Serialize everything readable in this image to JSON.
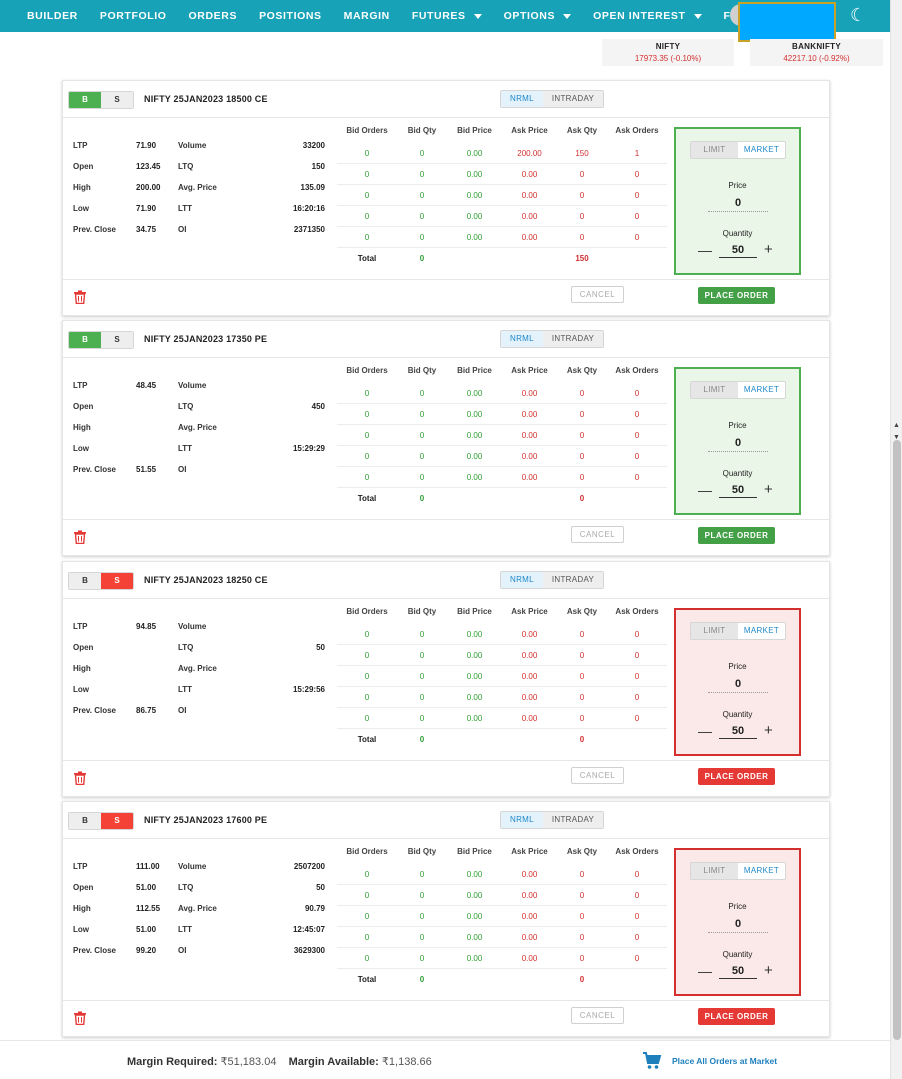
{
  "nav": {
    "items": [
      {
        "label": "BUILDER",
        "dropdown": false
      },
      {
        "label": "PORTFOLIO",
        "dropdown": false
      },
      {
        "label": "ORDERS",
        "dropdown": false
      },
      {
        "label": "POSITIONS",
        "dropdown": false
      },
      {
        "label": "MARGIN",
        "dropdown": false
      },
      {
        "label": "FUTURES",
        "dropdown": true
      },
      {
        "label": "OPTIONS",
        "dropdown": true
      },
      {
        "label": "OPEN INTEREST",
        "dropdown": true
      },
      {
        "label": "FII/DII",
        "dropdown": true
      }
    ],
    "theme_icon": "moon-icon",
    "accent_color": "#17a2b8"
  },
  "indices": [
    {
      "name": "NIFTY",
      "value": "17973.35 (-0.10%)"
    },
    {
      "name": "BANKNIFTY",
      "value": "42217.10 (-0.92%)"
    }
  ],
  "common": {
    "buy_label": "B",
    "sell_label": "S",
    "nrml_label": "NRML",
    "intraday_label": "INTRADAY",
    "limit_label": "LIMIT",
    "market_label": "MARKET",
    "price_label": "Price",
    "quantity_label": "Quantity",
    "minus_label": "—",
    "plus_label": "+",
    "cancel_label": "CANCEL",
    "place_label": "PLACE ORDER",
    "total_label": "Total",
    "stat_labels": {
      "ltp": "LTP",
      "open": "Open",
      "high": "High",
      "low": "Low",
      "prev_close": "Prev. Close",
      "volume": "Volume",
      "ltq": "LTQ",
      "avg_price": "Avg. Price",
      "ltt": "LTT",
      "oi": "OI"
    },
    "depth_headers": [
      "Bid Orders",
      "Bid Qty",
      "Bid Price",
      "Ask Price",
      "Ask Qty",
      "Ask Orders"
    ]
  },
  "orders": [
    {
      "side": "buy",
      "title": "NIFTY 25JAN2023 18500 CE",
      "product": "NRML",
      "order_type": "MARKET",
      "stats": {
        "ltp": "71.90",
        "open": "123.45",
        "high": "200.00",
        "low": "71.90",
        "prev_close": "34.75",
        "volume": "33200",
        "ltq": "150",
        "avg_price": "135.09",
        "ltt": "16:20:16",
        "oi": "2371350"
      },
      "depth": [
        [
          "0",
          "0",
          "0.00",
          "200.00",
          "150",
          "1"
        ],
        [
          "0",
          "0",
          "0.00",
          "0.00",
          "0",
          "0"
        ],
        [
          "0",
          "0",
          "0.00",
          "0.00",
          "0",
          "0"
        ],
        [
          "0",
          "0",
          "0.00",
          "0.00",
          "0",
          "0"
        ],
        [
          "0",
          "0",
          "0.00",
          "0.00",
          "0",
          "0"
        ]
      ],
      "total_bid": "0",
      "total_ask": "150",
      "price": "0",
      "quantity": "50"
    },
    {
      "side": "buy",
      "title": "NIFTY 25JAN2023 17350 PE",
      "product": "NRML",
      "order_type": "MARKET",
      "stats": {
        "ltp": "48.45",
        "open": "",
        "high": "",
        "low": "",
        "prev_close": "51.55",
        "volume": "",
        "ltq": "450",
        "avg_price": "",
        "ltt": "15:29:29",
        "oi": ""
      },
      "depth": [
        [
          "0",
          "0",
          "0.00",
          "0.00",
          "0",
          "0"
        ],
        [
          "0",
          "0",
          "0.00",
          "0.00",
          "0",
          "0"
        ],
        [
          "0",
          "0",
          "0.00",
          "0.00",
          "0",
          "0"
        ],
        [
          "0",
          "0",
          "0.00",
          "0.00",
          "0",
          "0"
        ],
        [
          "0",
          "0",
          "0.00",
          "0.00",
          "0",
          "0"
        ]
      ],
      "total_bid": "0",
      "total_ask": "0",
      "price": "0",
      "quantity": "50"
    },
    {
      "side": "sell",
      "title": "NIFTY 25JAN2023 18250 CE",
      "product": "NRML",
      "order_type": "MARKET",
      "stats": {
        "ltp": "94.85",
        "open": "",
        "high": "",
        "low": "",
        "prev_close": "86.75",
        "volume": "",
        "ltq": "50",
        "avg_price": "",
        "ltt": "15:29:56",
        "oi": ""
      },
      "depth": [
        [
          "0",
          "0",
          "0.00",
          "0.00",
          "0",
          "0"
        ],
        [
          "0",
          "0",
          "0.00",
          "0.00",
          "0",
          "0"
        ],
        [
          "0",
          "0",
          "0.00",
          "0.00",
          "0",
          "0"
        ],
        [
          "0",
          "0",
          "0.00",
          "0.00",
          "0",
          "0"
        ],
        [
          "0",
          "0",
          "0.00",
          "0.00",
          "0",
          "0"
        ]
      ],
      "total_bid": "0",
      "total_ask": "0",
      "price": "0",
      "quantity": "50"
    },
    {
      "side": "sell",
      "title": "NIFTY 25JAN2023 17600 PE",
      "product": "NRML",
      "order_type": "MARKET",
      "stats": {
        "ltp": "111.00",
        "open": "51.00",
        "high": "112.55",
        "low": "51.00",
        "prev_close": "99.20",
        "volume": "2507200",
        "ltq": "50",
        "avg_price": "90.79",
        "ltt": "12:45:07",
        "oi": "3629300"
      },
      "depth": [
        [
          "0",
          "0",
          "0.00",
          "0.00",
          "0",
          "0"
        ],
        [
          "0",
          "0",
          "0.00",
          "0.00",
          "0",
          "0"
        ],
        [
          "0",
          "0",
          "0.00",
          "0.00",
          "0",
          "0"
        ],
        [
          "0",
          "0",
          "0.00",
          "0.00",
          "0",
          "0"
        ],
        [
          "0",
          "0",
          "0.00",
          "0.00",
          "0",
          "0"
        ]
      ],
      "total_bid": "0",
      "total_ask": "0",
      "price": "0",
      "quantity": "50"
    }
  ],
  "footer": {
    "margin_required_label": "Margin Required:",
    "margin_required_value": "₹51,183.04",
    "margin_available_label": "Margin Available:",
    "margin_available_value": "₹1,138.66",
    "place_all_label": "Place All Orders at Market",
    "cart_icon": "cart-icon"
  },
  "colors": {
    "buy": "#4caf50",
    "sell": "#f44336",
    "positive": "#2e9e32",
    "negative": "#d32f2f",
    "link": "#1e7fbd"
  }
}
